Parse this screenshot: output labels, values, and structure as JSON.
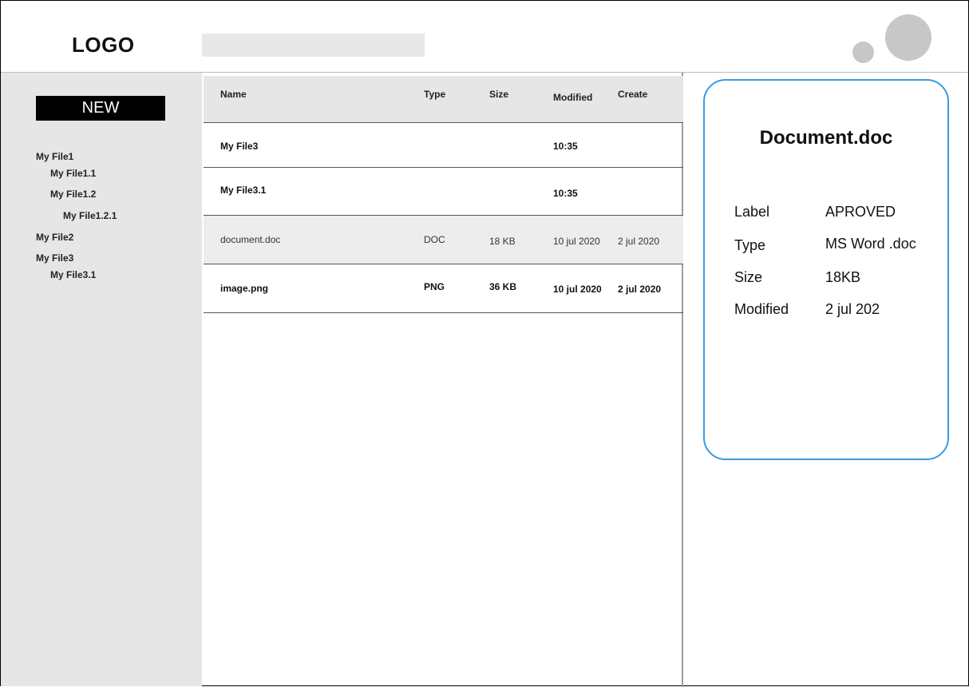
{
  "header": {
    "logo": "LOGO"
  },
  "sidebar": {
    "new_label": "NEW",
    "tree": [
      {
        "label": "My File1"
      },
      {
        "label": "My File1.1"
      },
      {
        "label": "My File1.2"
      },
      {
        "label": "My File1.2.1"
      },
      {
        "label": "My File2"
      },
      {
        "label": "My File3"
      },
      {
        "label": "My File3.1"
      }
    ]
  },
  "file_list": {
    "columns": [
      "Name",
      "Type",
      "Size",
      "Modified",
      "Create"
    ],
    "rows": [
      {
        "name": "My File3",
        "type": "",
        "size": "",
        "modified": "10:35",
        "created": ""
      },
      {
        "name": "My File3.1",
        "type": "",
        "size": "",
        "modified": "10:35",
        "created": ""
      },
      {
        "name": "document.doc",
        "type": "DOC",
        "size": "18 KB",
        "modified": "10 jul 2020",
        "created": "2 jul 2020"
      },
      {
        "name": "image.png",
        "type": "PNG",
        "size": "36 KB",
        "modified": "10 jul 2020",
        "created": "2 jul 2020"
      }
    ]
  },
  "details": {
    "title": "Document.doc",
    "properties": [
      {
        "label": "Label",
        "value": "APROVED"
      },
      {
        "label": "Type",
        "value": "MS Word .doc"
      },
      {
        "label": "Size",
        "value": "18KB"
      },
      {
        "label": "Modified",
        "value": "2 jul 202"
      }
    ]
  },
  "colors": {
    "card_border": "#3a9be0",
    "sidebar_bg": "#e6e6e6",
    "new_button_bg": "#000000"
  }
}
